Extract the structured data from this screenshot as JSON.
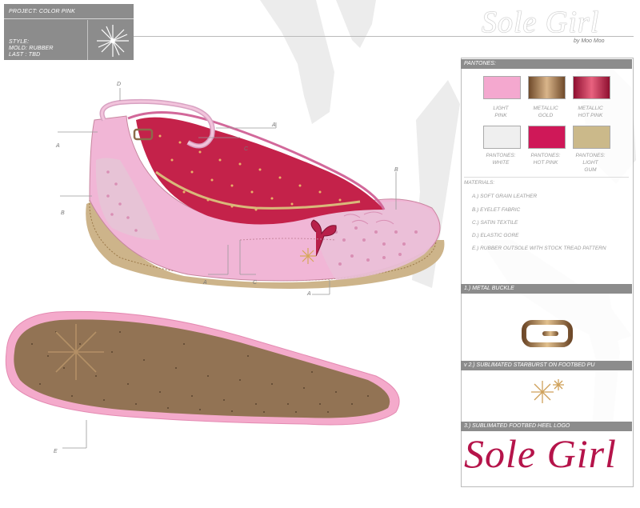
{
  "header": {
    "project": "PROJECT: COLOR PINK",
    "style": "STYLE:",
    "mold": "MOLD: RUBBER",
    "last": "LAST : TBD"
  },
  "brand": {
    "logo": "Sole Girl",
    "byline": "by Moo Moo"
  },
  "pantones": {
    "title": "PANTONES:",
    "swatches": [
      {
        "label": [
          "LIGHT",
          "PINK"
        ],
        "color": "#f4a8cf"
      },
      {
        "label": [
          "METALLIC",
          "GOLD"
        ],
        "color": "#a8825a"
      },
      {
        "label": [
          "METALLIC",
          "HOT PINK"
        ],
        "color": "#c8244e"
      },
      {
        "label": [
          "PANTONES:",
          "WHITE"
        ],
        "color": "#efefef"
      },
      {
        "label": [
          "PANTONES:",
          "HOT PINK"
        ],
        "color": "#cf1858"
      },
      {
        "label": [
          "PANTONES:",
          "LIGHT",
          "GUM"
        ],
        "color": "#cbb98a"
      }
    ]
  },
  "materials": {
    "title": "MATERIALS:",
    "items": [
      "A.) SOFT GRAIN LEATHER",
      "B.) EYELET FABRIC",
      "C.) SATIN TEXTILE",
      "D.) ELASTIC GORE",
      "E.) RUBBER OUTSOLE WITH STOCK TREAD PATTERN"
    ]
  },
  "details": [
    {
      "title": "1.) METAL BUCKLE"
    },
    {
      "title": "v 2.) SUBLIMATED STARBURST ON FOOTBED PU"
    },
    {
      "title": "3.) SUBLIMATED FOOTBED HEEL LOGO",
      "logo": "Sole Girl"
    }
  ],
  "callouts": {
    "a1": "A",
    "d": "D",
    "a2": "A",
    "c1": "C",
    "b1": "B",
    "b2": "B",
    "a3": "A",
    "c2": "C",
    "a4": "A",
    "e": "E"
  }
}
